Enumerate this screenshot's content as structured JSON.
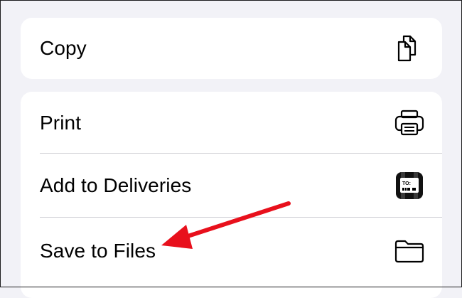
{
  "share_sheet": {
    "copy_label": "Copy",
    "print_label": "Print",
    "deliveries_label": "Add to Deliveries",
    "deliveries_tag_text": "TO:",
    "save_files_label": "Save to Files"
  },
  "icons": {
    "copy": "copy-icon",
    "print": "printer-icon",
    "deliveries": "deliveries-app-icon",
    "save_files": "folder-icon"
  },
  "colors": {
    "background": "#f2f2f7",
    "card": "#ffffff",
    "divider": "#d1d1d6",
    "annotation_arrow": "#e8101c"
  }
}
